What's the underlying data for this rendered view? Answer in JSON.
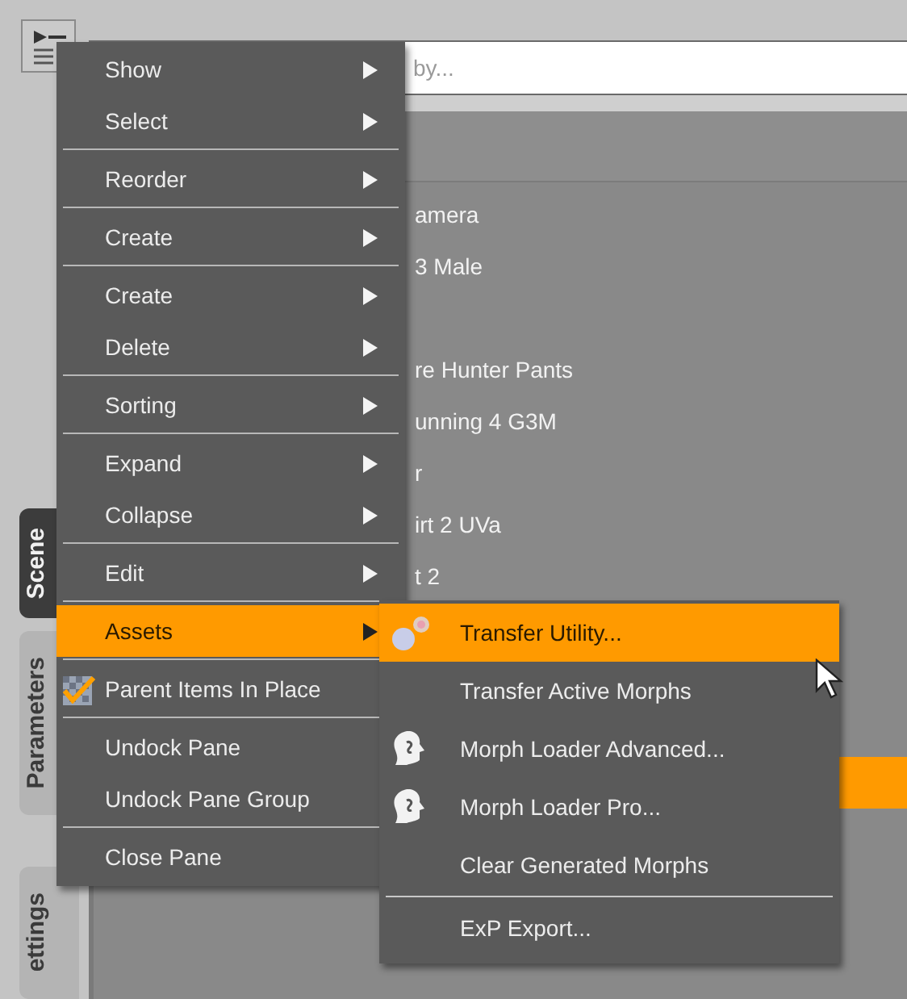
{
  "side_tabs": [
    {
      "label": "Scene",
      "selected": true
    },
    {
      "label": "Parameters",
      "selected": false
    },
    {
      "label": "ettings",
      "selected": false
    }
  ],
  "search": {
    "placeholder": "by..."
  },
  "tree": {
    "rows": [
      {
        "label": "amera",
        "selected": false
      },
      {
        "label": "3 Male",
        "selected": false
      },
      {
        "selected": false
      },
      {
        "label": "re Hunter Pants",
        "selected": false
      },
      {
        "label": "unning 4 G3M",
        "selected": false
      },
      {
        "label": "r",
        "selected": false
      },
      {
        "label": "irt 2 UVa",
        "selected": false
      },
      {
        "label": "t 2",
        "selected": false
      },
      {
        "selected": false
      },
      {
        "selected": false
      },
      {
        "selected": false
      },
      {
        "selected": true
      }
    ]
  },
  "menu": {
    "items": [
      {
        "kind": "item",
        "label": "Show",
        "submenu": true,
        "selected": false,
        "checked": false
      },
      {
        "kind": "item",
        "label": "Select",
        "submenu": true,
        "selected": false,
        "checked": false
      },
      {
        "kind": "separator"
      },
      {
        "kind": "item",
        "label": "Reorder",
        "submenu": true,
        "selected": false,
        "checked": false
      },
      {
        "kind": "separator"
      },
      {
        "kind": "item",
        "label": "Create",
        "submenu": true,
        "selected": false,
        "checked": false
      },
      {
        "kind": "separator"
      },
      {
        "kind": "item",
        "label": "Create",
        "submenu": true,
        "selected": false,
        "checked": false
      },
      {
        "kind": "item",
        "label": "Delete",
        "submenu": true,
        "selected": false,
        "checked": false
      },
      {
        "kind": "separator"
      },
      {
        "kind": "item",
        "label": "Sorting",
        "submenu": true,
        "selected": false,
        "checked": false
      },
      {
        "kind": "separator"
      },
      {
        "kind": "item",
        "label": "Expand",
        "submenu": true,
        "selected": false,
        "checked": false
      },
      {
        "kind": "item",
        "label": "Collapse",
        "submenu": true,
        "selected": false,
        "checked": false
      },
      {
        "kind": "separator"
      },
      {
        "kind": "item",
        "label": "Edit",
        "submenu": true,
        "selected": false,
        "checked": false
      },
      {
        "kind": "separator"
      },
      {
        "kind": "item",
        "label": "Assets",
        "submenu": true,
        "selected": true,
        "checked": false
      },
      {
        "kind": "separator"
      },
      {
        "kind": "item",
        "label": "Parent Items In Place",
        "submenu": false,
        "selected": false,
        "checked": true
      },
      {
        "kind": "separator"
      },
      {
        "kind": "item",
        "label": "Undock Pane",
        "submenu": false,
        "selected": false,
        "checked": false
      },
      {
        "kind": "item",
        "label": "Undock Pane Group",
        "submenu": false,
        "selected": false,
        "checked": false
      },
      {
        "kind": "separator"
      },
      {
        "kind": "item",
        "label": "Close Pane",
        "submenu": false,
        "selected": false,
        "checked": false
      }
    ]
  },
  "submenu": {
    "items": [
      {
        "kind": "dots",
        "label": "Transfer Utility...",
        "selected": true
      },
      {
        "kind": "plain",
        "label": "Transfer Active Morphs",
        "selected": false
      },
      {
        "kind": "head",
        "label": "Morph Loader Advanced...",
        "selected": false
      },
      {
        "kind": "head",
        "label": "Morph Loader Pro...",
        "selected": false
      },
      {
        "kind": "plain",
        "label": "Clear Generated Morphs",
        "selected": false
      },
      {
        "kind": "separator"
      },
      {
        "kind": "plain",
        "label": "ExP Export...",
        "selected": false
      }
    ]
  }
}
